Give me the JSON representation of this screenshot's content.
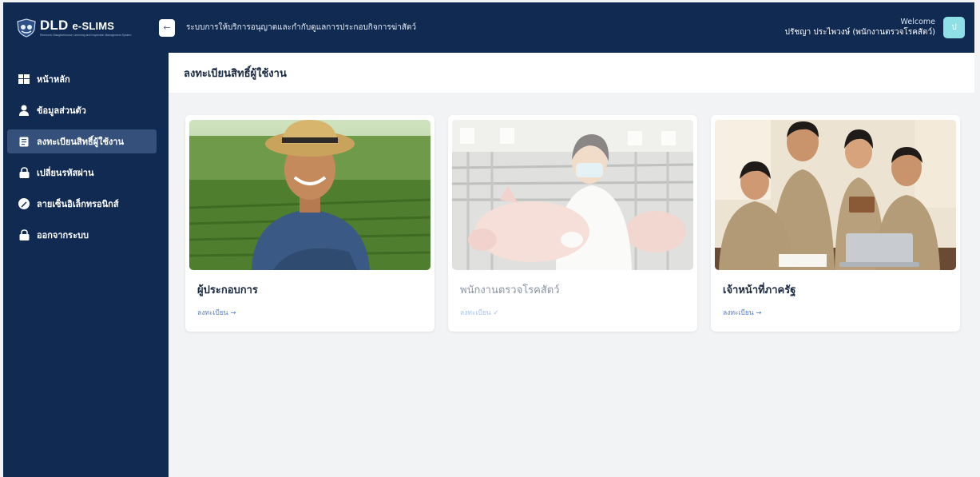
{
  "app": {
    "brand_name": "DLD",
    "brand_name_suffix": "e-SLIMS",
    "brand_subtitle": "Electronic Slaughterhouse Licensing and Inspection Management System",
    "system_title": "ระบบการให้บริการอนุญาตและกำกับดูแลการประกอบกิจการฆ่าสัตว์",
    "collapse_icon": "←"
  },
  "user": {
    "welcome": "Welcome",
    "name": "ปรัชญา ประไพวงษ์ (พนักงานตรวจโรคสัตว์)",
    "avatar_initial": "ป"
  },
  "sidebar": {
    "items": [
      {
        "label": "หน้าหลัก",
        "icon": "dashboard-icon"
      },
      {
        "label": "ข้อมูลส่วนตัว",
        "icon": "user-icon"
      },
      {
        "label": "ลงทะเบียนสิทธิ์ผู้ใช้งาน",
        "icon": "clipboard-icon",
        "active": true
      },
      {
        "label": "เปลี่ยนรหัสผ่าน",
        "icon": "lock-icon"
      },
      {
        "label": "ลายเซ็นอิเล็กทรอนิกส์",
        "icon": "pen-icon"
      },
      {
        "label": "ออกจากระบบ",
        "icon": "logout-lock-icon"
      }
    ]
  },
  "page": {
    "title": "ลงทะเบียนสิทธิ์ผู้ใช้งาน"
  },
  "cards": [
    {
      "title": "ผู้ประกอบการ",
      "link": "ลงทะเบียน →",
      "image": "farmer-photo",
      "disabled": false
    },
    {
      "title": "พนักงานตรวจโรคสัตว์",
      "link": "ลงทะเบียน ✓",
      "image": "veterinarian-pig-photo",
      "disabled": true
    },
    {
      "title": "เจ้าหน้าที่ภาครัฐ",
      "link": "ลงทะเบียน →",
      "image": "government-officers-photo",
      "disabled": false
    }
  ],
  "colors": {
    "navy": "#102a52",
    "active_nav": "#35507a",
    "link": "#4e7cc4",
    "avatar": "#8fe0e6"
  }
}
